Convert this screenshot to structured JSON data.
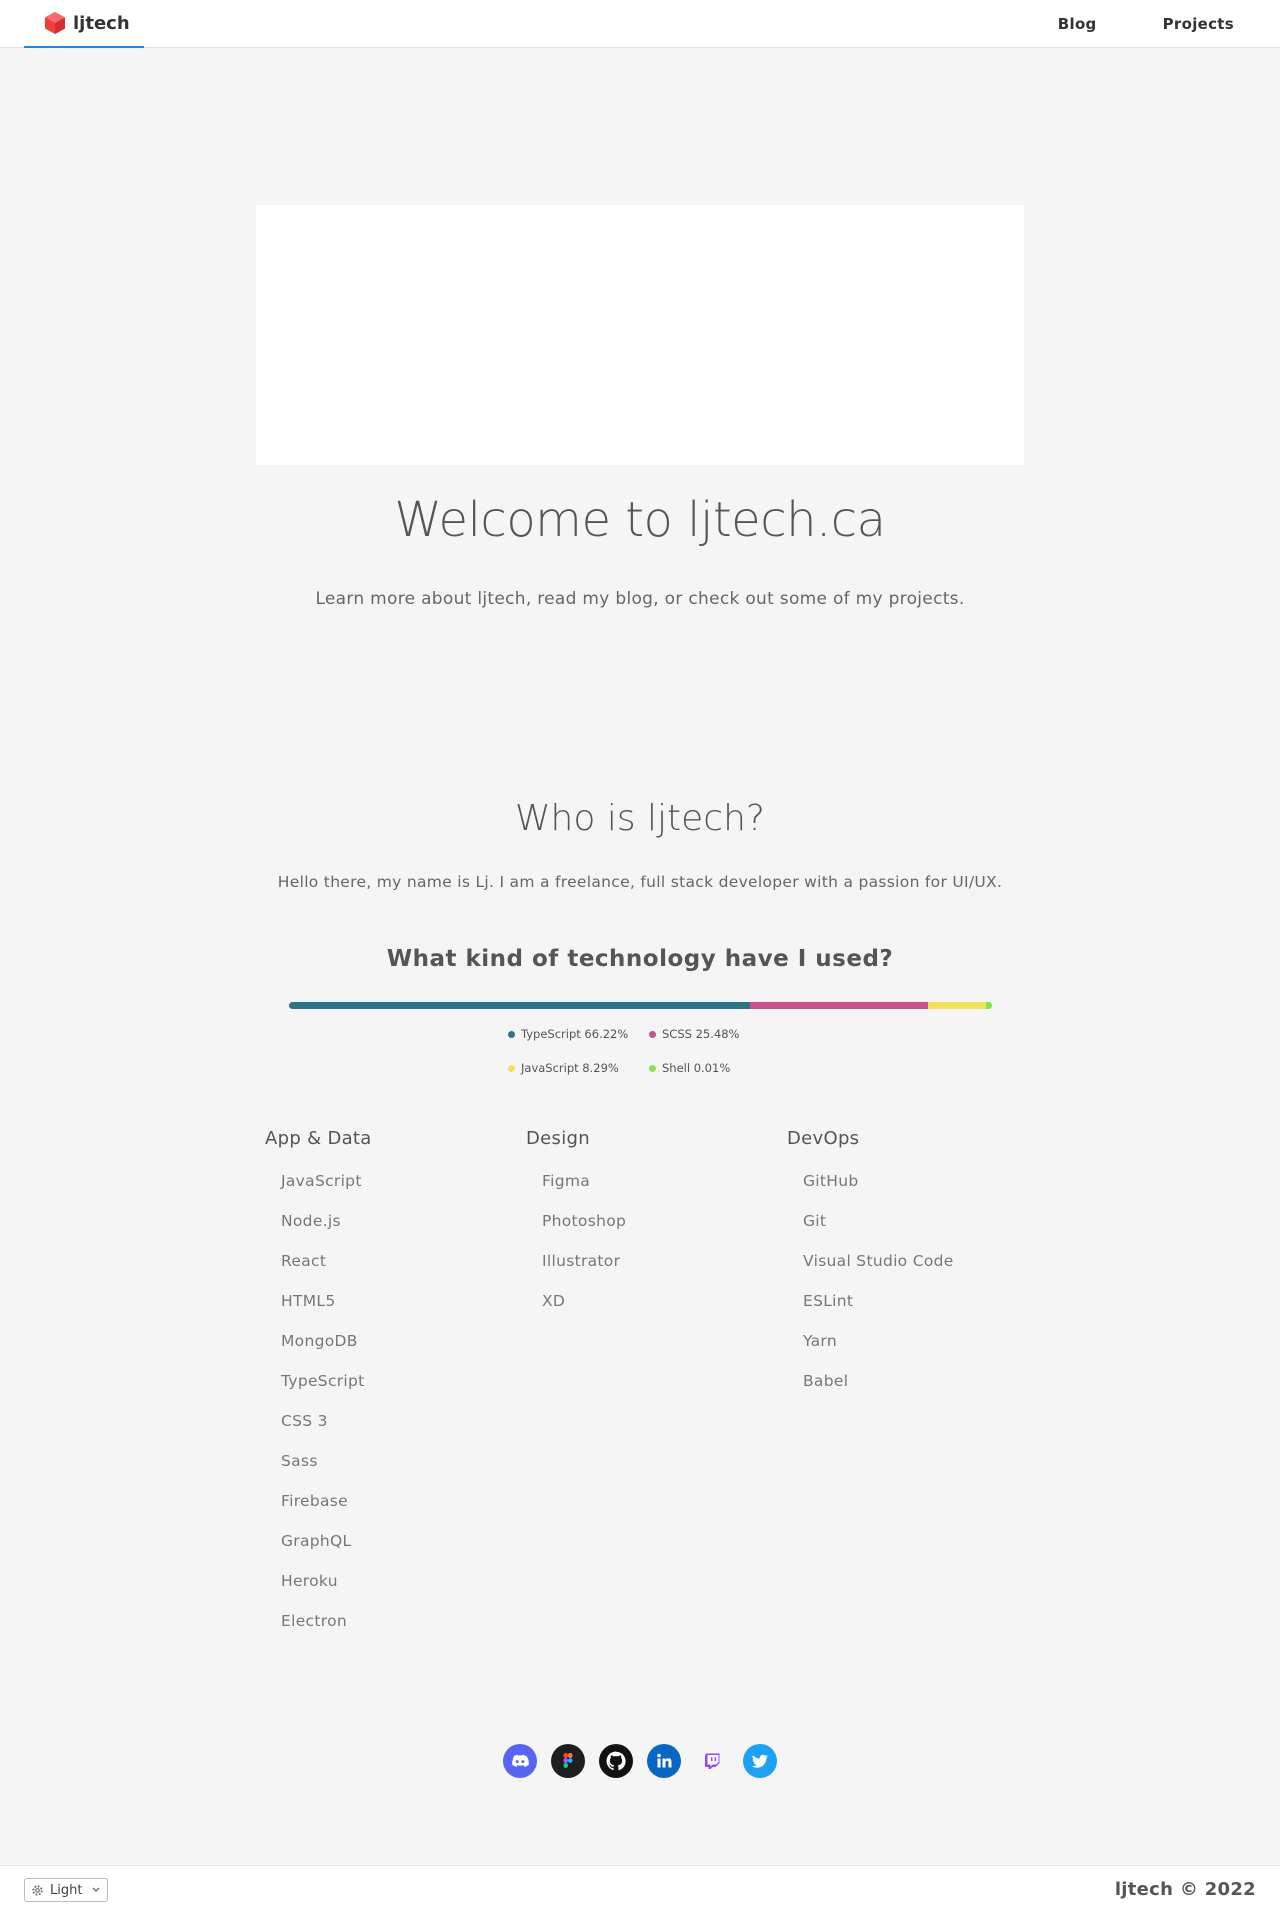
{
  "header": {
    "brand": "ljtech",
    "nav": [
      {
        "label": "Blog"
      },
      {
        "label": "Projects"
      }
    ]
  },
  "hero": {
    "title": "Welcome to ljtech.ca",
    "subtitle": "Learn more about ljtech, read my blog, or check out some of my projects."
  },
  "about": {
    "title": "Who is ljtech?",
    "text": "Hello there, my name is Lj. I am a freelance, full stack developer with a passion for UI/UX."
  },
  "technology": {
    "title": "What kind of technology have I used?",
    "languages": [
      {
        "name": "TypeScript",
        "percent": 66.22,
        "label": "TypeScript 66.22%",
        "color": "#2b7489"
      },
      {
        "name": "SCSS",
        "percent": 25.48,
        "label": "SCSS 25.48%",
        "color": "#c6538c"
      },
      {
        "name": "JavaScript",
        "percent": 8.29,
        "label": "JavaScript 8.29%",
        "color": "#f1e05a"
      },
      {
        "name": "Shell",
        "percent": 0.01,
        "label": "Shell 0.01%",
        "color": "#89e051"
      }
    ]
  },
  "stacks": [
    {
      "title": "App & Data",
      "items": [
        "JavaScript",
        "Node.js",
        "React",
        "HTML5",
        "MongoDB",
        "TypeScript",
        "CSS 3",
        "Sass",
        "Firebase",
        "GraphQL",
        "Heroku",
        "Electron"
      ]
    },
    {
      "title": "Design",
      "items": [
        "Figma",
        "Photoshop",
        "Illustrator",
        "XD"
      ]
    },
    {
      "title": "DevOps",
      "items": [
        "GitHub",
        "Git",
        "Visual Studio Code",
        "ESLint",
        "Yarn",
        "Babel"
      ]
    }
  ],
  "social": [
    {
      "icon": "discord-icon",
      "color": "#5865f2"
    },
    {
      "icon": "figma-icon",
      "color": "#1e1e1e"
    },
    {
      "icon": "github-icon",
      "color": "#111111"
    },
    {
      "icon": "linkedin-icon",
      "color": "#0a66c2"
    },
    {
      "icon": "twitch-icon",
      "color": "#9146ff"
    },
    {
      "icon": "twitter-icon",
      "color": "#1da1f2"
    }
  ],
  "footer": {
    "theme": "Light",
    "copyright": "ljtech © 2022"
  },
  "colors": {
    "accent": "#1e88e5",
    "logo": "#ef3e3e",
    "background": "#f5f5f5"
  }
}
